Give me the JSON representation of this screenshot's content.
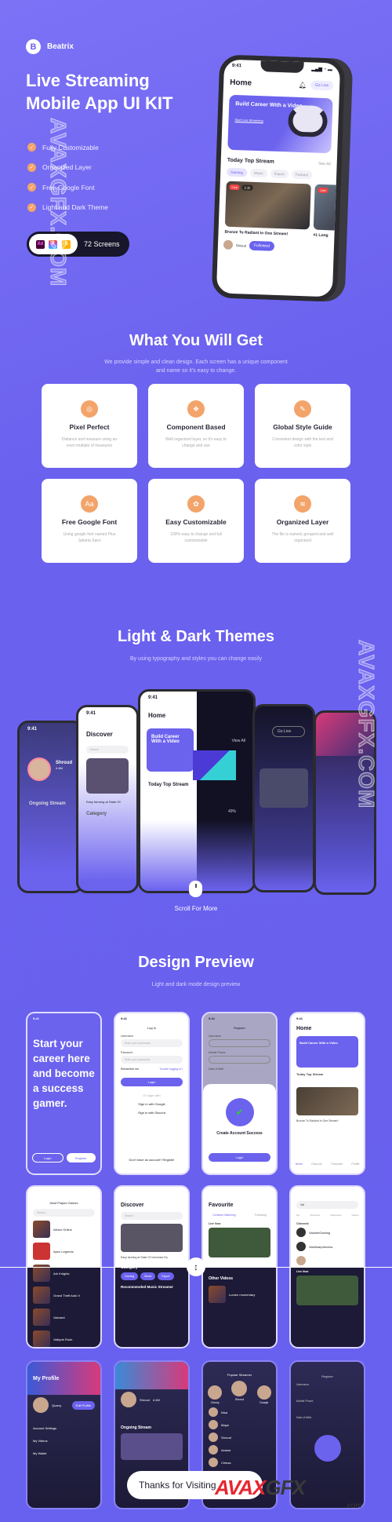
{
  "brand": {
    "letter": "B",
    "name": "Beatrix"
  },
  "hero": {
    "title_line1": "Live Streaming",
    "title_line2": "Mobile App UI KIT",
    "features": [
      "Fully Customizable",
      "Organized Layer",
      "Free Google Font",
      "Light and Dark Theme"
    ],
    "tools": [
      "Xd",
      "F",
      "S"
    ],
    "screens_label": "72 Screens"
  },
  "hero_phone": {
    "time": "9:41",
    "title": "Home",
    "go_live": "Go Live",
    "banner_title": "Build Career With a Video",
    "banner_link": "Start Live Streaming",
    "section": "Today Top Stream",
    "see_all": "See All",
    "chips": [
      "Gaming",
      "Music",
      "Esport",
      "Podcast"
    ],
    "live": "Live",
    "viewers": "2.1k",
    "caption": "Bronze To Radiant In One Stream!",
    "caption2": "#1 Long",
    "streamer": "Shroud",
    "follow": "Followed"
  },
  "what": {
    "title": "What You Will Get",
    "subtitle_line1": "We provide simple and clean design. Each screen has a unique component",
    "subtitle_line2": "and name so it's easy to change.",
    "cards": [
      {
        "icon": "pin-icon",
        "glyph": "◎",
        "title": "Pixel Perfect",
        "desc": "Distance and measure using an even multiple of measures"
      },
      {
        "icon": "component-icon",
        "glyph": "❖",
        "title": "Component Based",
        "desc": "Well organized layer, so it's easy to change and use"
      },
      {
        "icon": "style-icon",
        "glyph": "✎",
        "title": "Global Style Guide",
        "desc": "Consistent design with the text and color style"
      },
      {
        "icon": "font-icon",
        "glyph": "Aa",
        "title": "Free Google Font",
        "desc": "Using google font named Plus Jakarta Sans"
      },
      {
        "icon": "customize-icon",
        "glyph": "✿",
        "title": "Easy Customizable",
        "desc": "100% easy to change and full customizable"
      },
      {
        "icon": "layers-icon",
        "glyph": "≋",
        "title": "Organized Layer",
        "desc": "The file is named, grouped and well organized"
      }
    ]
  },
  "themes": {
    "title": "Light & Dark Themes",
    "subtitle": "By using typography and styles you can change easily",
    "scroll": "Scroll For More",
    "phones": {
      "time": "9:41",
      "profile_name": "Shroud",
      "profile_stat": "4.4M",
      "ongoing": "Ongoing Stream",
      "discover": "Discover",
      "search": "Search",
      "category": "Category",
      "discover_caption": "Easy farming at State Of",
      "home": "Home",
      "banner": "Build Career With a Video",
      "top": "Today Top Stream",
      "view_all": "View All",
      "percent": "49%",
      "go_live": "Go Live"
    }
  },
  "preview": {
    "title": "Design Preview",
    "subtitle": "Light and dark mode design preview",
    "onboard": {
      "headline": "Start your career here and become a success gamer.",
      "login": "Login",
      "register": "Register"
    },
    "login": {
      "title": "Log In",
      "username": "Username",
      "username_ph": "Enter your username",
      "password": "Password",
      "password_ph": "Enter your password",
      "remember": "Remember me",
      "forgot": "Trouble logging in?",
      "button": "Login",
      "or": "Or login with",
      "google": "Sign in with Google",
      "discord": "Sign in with Discord",
      "footer": "Don't have an account? Register"
    },
    "register": {
      "title": "Register",
      "username": "Username",
      "mobile": "Mobile Phone",
      "dob": "Date of Birth",
      "success": "Create Account Success",
      "button": "Login"
    },
    "home": {
      "title": "Home",
      "banner": "Build Career With a Video",
      "top": "Today Top Stream",
      "caption": "Bronze To Radiant In One Stream!",
      "nav": [
        "Home",
        "Discover",
        "Favourite",
        "Profile"
      ]
    },
    "games": {
      "title": "Most Played Games",
      "search": "Search",
      "items": [
        "Albion Online",
        "Apex Legends",
        "Ark Knights",
        "Grand Theft Auto V",
        "Valorant",
        "Valkyrie Rush"
      ]
    },
    "discover": {
      "title": "Discover",
      "search": "Search",
      "caption": "Easy farming at State Of Indonesia Rp",
      "category": "Category",
      "chips": [
        "Gaming",
        "Music",
        "Esport"
      ],
      "recommended": "Recommended Music Streamer"
    },
    "favourite": {
      "title": "Favourite",
      "tabs": [
        "Continue Watching",
        "Following"
      ],
      "live_now": "Live Now",
      "caption": "Unarchived monday japanese song",
      "other": "Other Videos",
      "video": "Lumen momentary"
    },
    "search": {
      "query": "Val",
      "tabs": [
        "Top",
        "Channels",
        "Categories",
        "Videos"
      ],
      "channels": "Channels",
      "see_all": "See All",
      "items": [
        "ValdmirGaming",
        "Valdimarprincess",
        "ValorNox"
      ],
      "follow": "Follow",
      "live_now": "Live Now"
    },
    "profile": {
      "title": "My Profile",
      "name": "Quarry",
      "edit": "Edit Profile",
      "items": [
        "Account Settings",
        "My Videos",
        "My Wallet"
      ]
    },
    "streamer": {
      "name": "Shroud",
      "stat": "4.4M",
      "ongoing": "Ongoing Stream"
    },
    "popular": {
      "title": "Popular Streamer",
      "top": [
        "Chinny",
        "Shroud",
        "Doaqie"
      ],
      "list": [
        "Nisa",
        "Maya",
        "Shroud",
        "Azawa",
        "Chinsa"
      ]
    },
    "register_dark": {
      "title": "Register",
      "username": "Username",
      "mobile": "Mobile Phone",
      "dob": "Date of Birth"
    }
  },
  "footer": {
    "thanks": "Thanks for Visiting"
  },
  "watermark": {
    "text": "AVAXGFX.COM",
    "logo_a": "AVAX",
    "logo_b": "GFX",
    "logo_com": ".com"
  },
  "colors": {
    "primary": "#6b62ee",
    "accent": "#f3a46a",
    "live": "#ee4444",
    "dark": "#1c1a36"
  }
}
